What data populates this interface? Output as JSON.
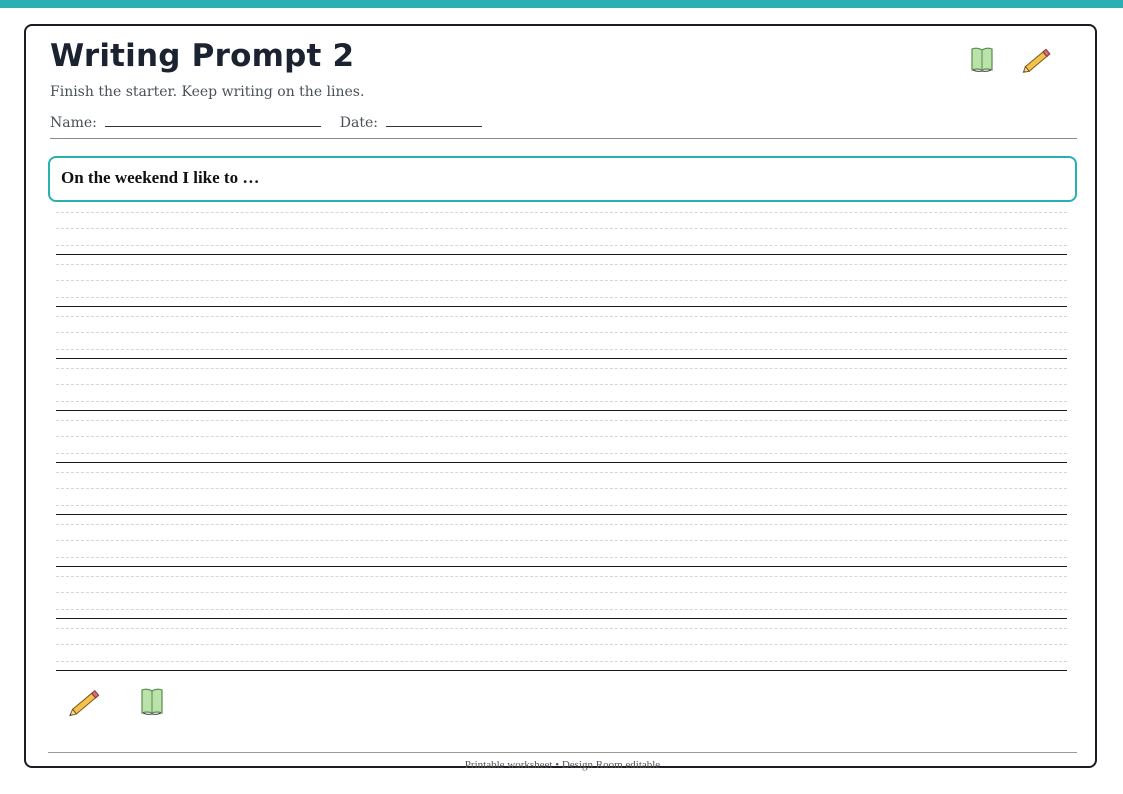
{
  "worksheet": {
    "title": "Writing Prompt 2",
    "subtitle": "Finish the starter. Keep writing on the lines.",
    "name_label": "Name:",
    "date_label": "Date:",
    "prompt": "On the weekend I like to …",
    "writing_line_count": 9,
    "footer": "Printable worksheet • Design Room editable"
  },
  "icons": {
    "top": [
      "book-icon",
      "pencil-icon"
    ],
    "bottom": [
      "pencil-icon",
      "book-icon"
    ]
  },
  "colors": {
    "accent": "#2ab0b3",
    "book": "#b9e3a8",
    "pencil": "#f2c14e"
  }
}
